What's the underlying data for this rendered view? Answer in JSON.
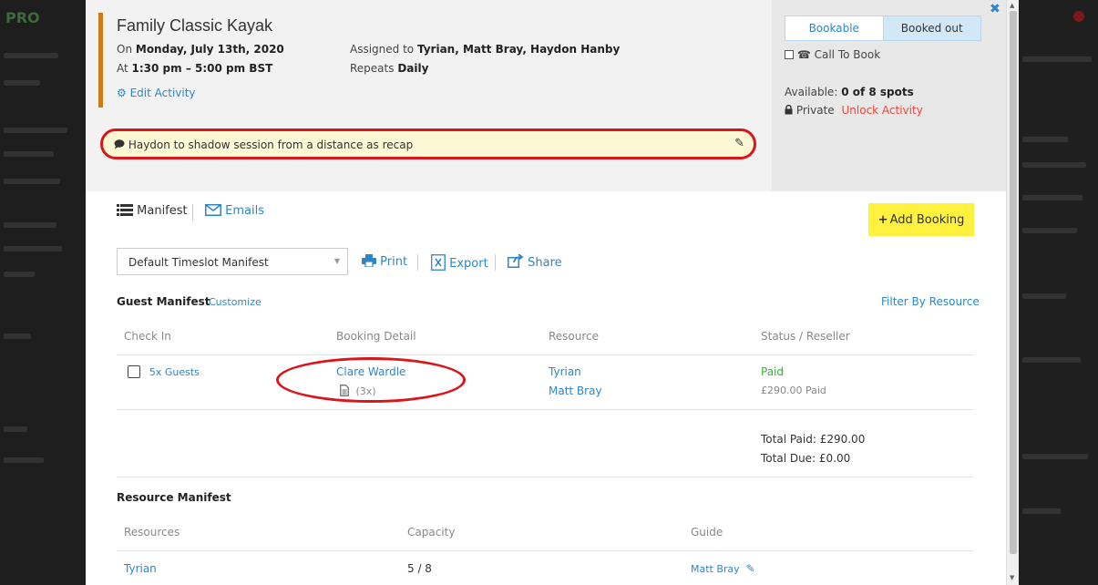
{
  "background": {
    "logo_text": "PRO"
  },
  "activity": {
    "title": "Family Classic Kayak",
    "date_prefix": "On ",
    "date": "Monday, July 13th, 2020",
    "time_prefix": "At ",
    "time": "1:30 pm – 5:00 pm BST",
    "edit_label": "Edit Activity",
    "assigned_prefix": "Assigned to ",
    "assigned": "Tyrian, Matt Bray, Haydon Hanby",
    "repeats_prefix": "Repeats ",
    "repeats": "Daily",
    "note": "Haydon to shadow session from a distance as recap"
  },
  "availability": {
    "bookable_label": "Bookable",
    "booked_out_label": "Booked out",
    "call_to_book_label": "Call To Book",
    "available_prefix": "Available: ",
    "available_value": "0 of 8 spots",
    "private_label": "Private",
    "unlock_label": "Unlock Activity"
  },
  "manifest_tabs": {
    "manifest_label": "Manifest",
    "emails_label": "Emails"
  },
  "add_booking_label": "Add Booking",
  "manifest_select": {
    "value": "Default Timeslot Manifest"
  },
  "toolbar": {
    "print_label": "Print",
    "export_label": "Export",
    "share_label": "Share"
  },
  "guest_manifest": {
    "title": "Guest Manifest",
    "customize_label": "Customize",
    "filter_label": "Filter By Resource",
    "columns": [
      "Check In",
      "Booking Detail",
      "Resource",
      "Status / Reseller"
    ],
    "row": {
      "guests": "5x Guests",
      "booking_name": "Clare Wardle",
      "booking_count": "(3x)",
      "resources": [
        "Tyrian",
        "Matt Bray"
      ],
      "status": "Paid",
      "status_detail": "£290.00 Paid"
    },
    "total_paid": "Total Paid: £290.00",
    "total_due": "Total Due: £0.00"
  },
  "resource_manifest": {
    "title": "Resource Manifest",
    "columns": [
      "Resources",
      "Capacity",
      "Guide"
    ],
    "row": {
      "resource": "Tyrian",
      "capacity": "5 / 8",
      "guide": "Matt Bray"
    }
  },
  "colors": {
    "accent": "#d07a16",
    "link": "#2f86c6",
    "highlight": "#d8161b",
    "add_button": "#fff23f",
    "paid": "#39b039",
    "unlock": "#e8483a"
  }
}
